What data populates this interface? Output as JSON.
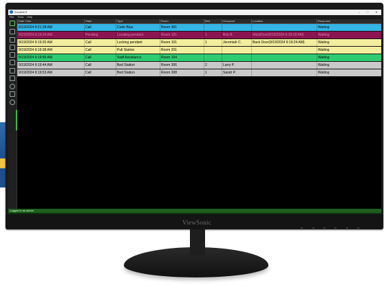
{
  "window": {
    "title": "Vocalink II",
    "min": "–",
    "max": "□",
    "close": "✕"
  },
  "menu": [
    "File",
    "Tools",
    "Help"
  ],
  "monitor": {
    "brand": "ViewSonic"
  },
  "toolbar": [
    "back-icon",
    "expand-icon",
    "printer-icon",
    "grid-icon",
    "layout-icon",
    "camera-icon",
    "send-icon",
    "volume-icon",
    "clock-icon",
    "equalizer-icon",
    "help-icon"
  ],
  "table": {
    "columns": [
      "Date Time",
      "State",
      "Type",
      "Room",
      "Bed",
      "Occupant",
      "Location",
      "Response"
    ],
    "rows": [
      {
        "cells": [
          "9/19/2024 9:21:28 AM",
          "Call",
          "Code Blue",
          "Room 301",
          "",
          "",
          "",
          "Waiting"
        ],
        "bg": "#33b5e5",
        "fg": "#000000"
      },
      {
        "cells": [
          "9/19/2024 9:19:24 AM",
          "Pending",
          "Locating pendant",
          "Room 101",
          "1",
          "Bob B.",
          "WestDoor(9/19/2024 9:19:18 AM)",
          "Waiting"
        ],
        "bg": "#8b1550",
        "fg": "#e07fb0"
      },
      {
        "cells": [
          "9/19/2024 9:19:20 AM",
          "Call",
          "Locking pendant",
          "Room 101",
          "1",
          "Jeremiah C.",
          "Back Door(9/19/2024 9:19:24 AM)",
          "Waiting"
        ],
        "bg": "#f3ee9e",
        "fg": "#000000"
      },
      {
        "cells": [
          "9/19/2024 9:19:38 AM",
          "Call",
          "Pull Station",
          "Room 201",
          "",
          "",
          "",
          "Waiting"
        ],
        "bg": "#f3ee9e",
        "fg": "#000000"
      },
      {
        "cells": [
          "9/19/2024 9:19:55 AM",
          "Call",
          "Staff Assistance",
          "Room 104",
          "",
          "",
          "",
          "Waiting"
        ],
        "bg": "#2ecc71",
        "fg": "#000000"
      },
      {
        "cells": [
          "9/19/2024 9:19:44 AM",
          "Call",
          "Bed Station",
          "Room 306",
          "2",
          "Larry P.",
          "",
          "Waiting"
        ],
        "bg": "#c9c9c9",
        "fg": "#000000"
      },
      {
        "cells": [
          "9/19/2024 9:19:53 AM",
          "Call",
          "Bed Station",
          "Room 308",
          "1",
          "Sarah P.",
          "",
          "Waiting"
        ],
        "bg": "#c9c9c9",
        "fg": "#000000"
      }
    ]
  },
  "status": {
    "text": "Logged in as admin"
  }
}
